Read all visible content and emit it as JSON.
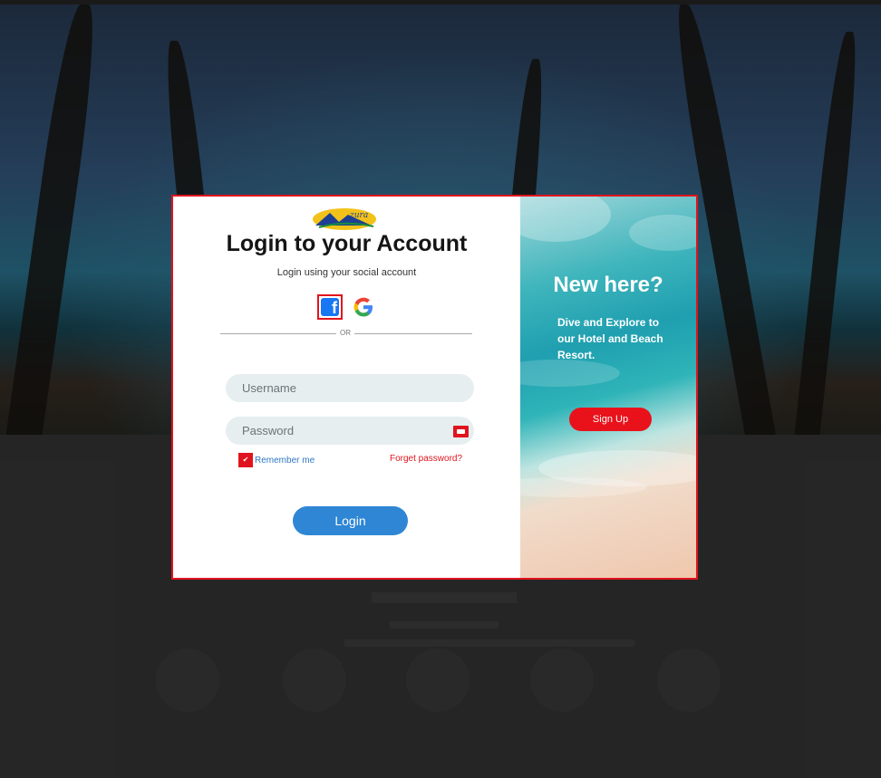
{
  "app": {
    "logo_text": "Azura"
  },
  "login": {
    "title": "Login to your Account",
    "subtitle": "Login using your social account",
    "or_label": "OR",
    "username_placeholder": "Username",
    "password_placeholder": "Password",
    "remember_label": "Remember me",
    "forgot_label": "Forget password?",
    "login_label": "Login"
  },
  "signup_panel": {
    "heading": "New here?",
    "tagline": "Dive and Explore to our Hotel and Beach Resort.",
    "signup_label": "Sign Up"
  },
  "colors": {
    "accent_red": "#e0141e",
    "primary_blue": "#2f86d4",
    "input_bg": "#e6eef0",
    "facebook_blue": "#1877f2"
  },
  "icons": [
    "facebook-icon",
    "google-icon",
    "password-visibility-icon",
    "checkbox-check-icon"
  ]
}
